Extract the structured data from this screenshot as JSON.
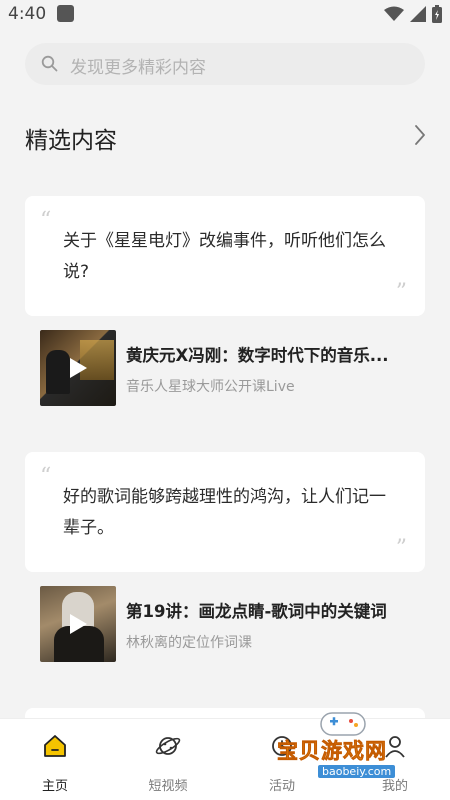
{
  "status": {
    "time": "4:40"
  },
  "search": {
    "placeholder": "发现更多精彩内容"
  },
  "section": {
    "title": "精选内容"
  },
  "feed": [
    {
      "quote": "关于《星星电灯》改编事件，听听他们怎么说?",
      "media_title": "黄庆元X冯刚：数字时代下的音乐...",
      "media_subtitle": "音乐人星球大师公开课Live"
    },
    {
      "quote": "好的歌词能够跨越理性的鸿沟，让人们记一辈子。",
      "media_title": "第19讲：画龙点睛-歌词中的关键词",
      "media_subtitle": "林秋离的定位作词课"
    }
  ],
  "tabs": [
    {
      "label": "主页",
      "icon": "home-icon",
      "active": true
    },
    {
      "label": "短视频",
      "icon": "planet-icon",
      "active": false
    },
    {
      "label": "活动",
      "icon": "activity-icon",
      "active": false
    },
    {
      "label": "我的",
      "icon": "profile-icon",
      "active": false
    }
  ],
  "watermark": {
    "text": "宝贝游戏网",
    "url": "baobeiy.com"
  },
  "colors": {
    "accent": "#f5c400",
    "background": "#f3f3f3",
    "card": "#ffffff"
  }
}
